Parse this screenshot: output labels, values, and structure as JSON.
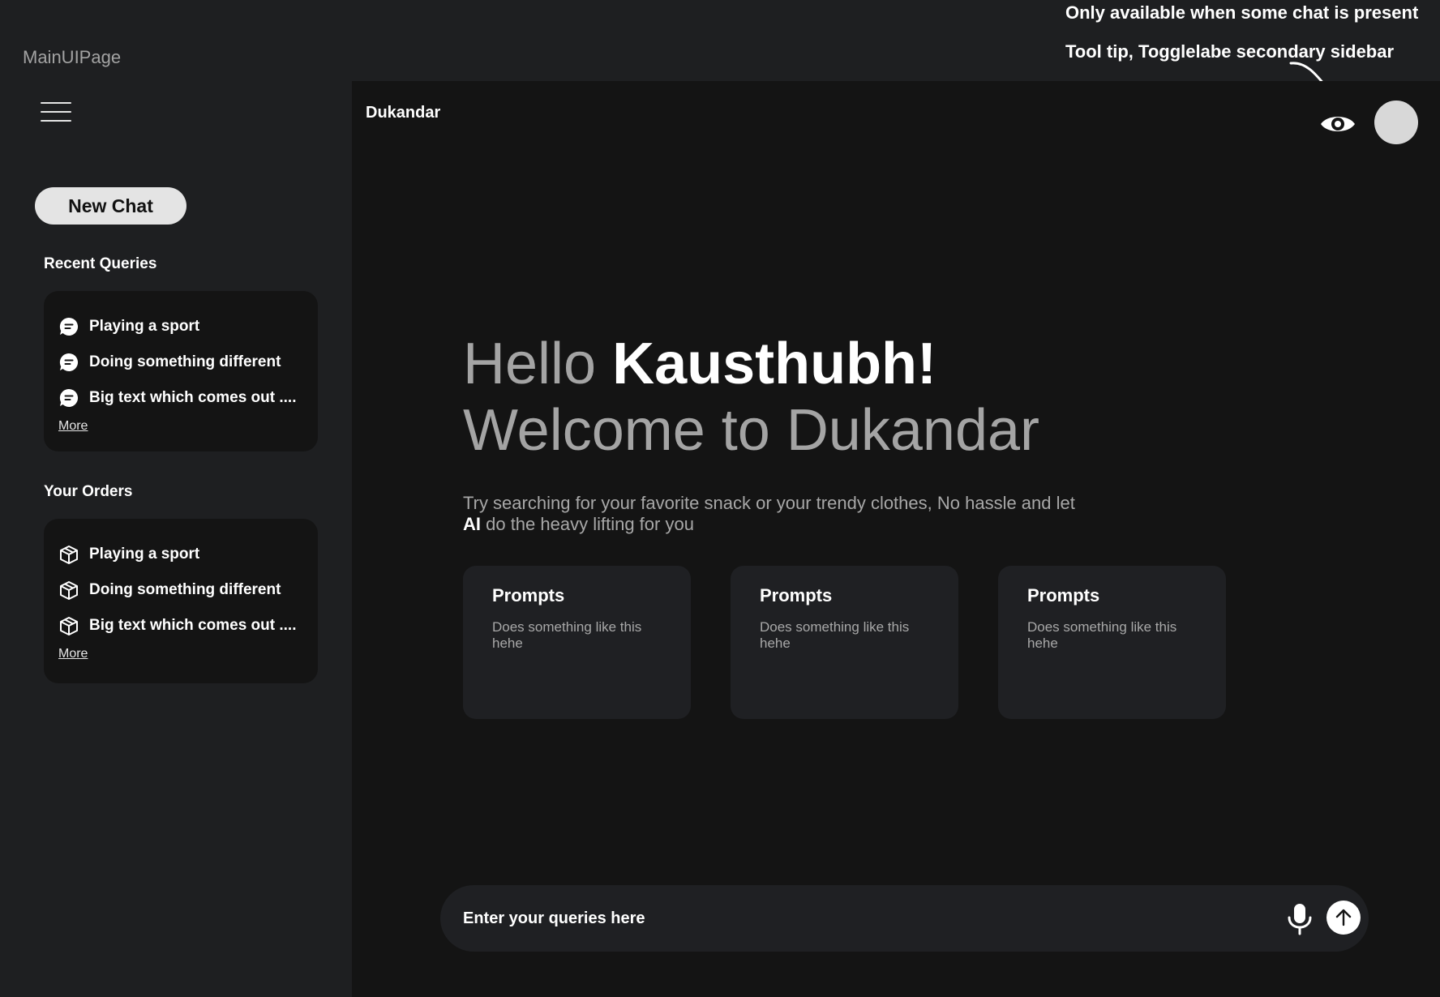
{
  "frame": {
    "label": "MainUIPage"
  },
  "annotations": {
    "availability_note": "Only available when some chat is present",
    "tooltip_note": "Tool tip, Togglelabe secondary sidebar"
  },
  "sidebar": {
    "menu_icon": "hamburger-menu-icon",
    "new_chat_label": "New Chat",
    "recent": {
      "title": "Recent  Queries",
      "icon": "chat-bubble-icon",
      "items": [
        {
          "label": "Playing a sport"
        },
        {
          "label": "Doing something different"
        },
        {
          "label": "Big text which comes out ...."
        }
      ],
      "more_label": "More"
    },
    "orders": {
      "title": "Your Orders",
      "icon": "package-box-icon",
      "items": [
        {
          "label": "Playing a sport"
        },
        {
          "label": "Doing something different"
        },
        {
          "label": "Big text which comes out ...."
        }
      ],
      "more_label": "More"
    }
  },
  "header": {
    "brand": "Dukandar",
    "toggle_icon": "eye-icon"
  },
  "hero": {
    "hello_prefix": "Hello ",
    "user_name": "Kausthubh!",
    "welcome": "Welcome to Dukandar",
    "subtitle_part1": "Try searching for your favorite snack or your trendy clothes, No hassle and let ",
    "subtitle_bold": "AI",
    "subtitle_part2": " do the heavy lifting for you"
  },
  "prompts": [
    {
      "title": "Prompts",
      "description": "Does something like this hehe"
    },
    {
      "title": "Prompts",
      "description": "Does something like this hehe"
    },
    {
      "title": "Prompts",
      "description": "Does something like this hehe"
    }
  ],
  "query_bar": {
    "placeholder": "Enter your queries here",
    "mic_icon": "microphone-icon",
    "send_icon": "arrow-up-icon"
  },
  "colors": {
    "frame_bg": "#1e1f21",
    "main_bg": "#141414",
    "card_bg": "#1f2023",
    "muted_text": "#a4a4a4",
    "button_bg": "#e4e4e4"
  }
}
